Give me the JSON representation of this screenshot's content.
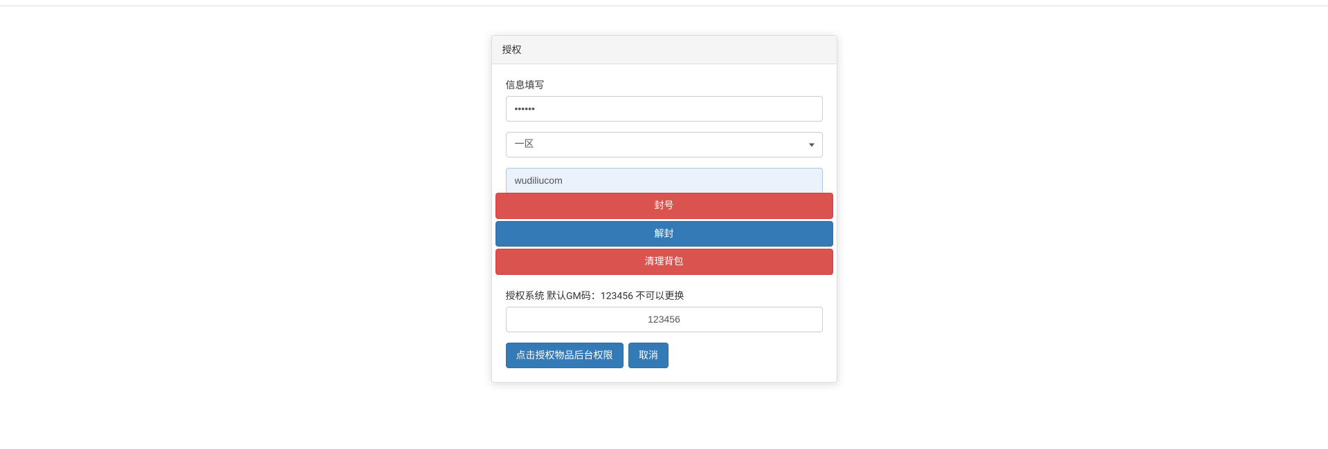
{
  "panel": {
    "title": "授权"
  },
  "form": {
    "info_label": "信息填写",
    "password_value": "••••••",
    "zone_selected": "一区",
    "account_value": "wudiliucom"
  },
  "actions": {
    "ban_label": "封号",
    "unban_label": "解封",
    "clear_bag_label": "清理背包"
  },
  "auth": {
    "gm_label": "授权系统 默认GM码：123456 不可以更换",
    "gm_value": "123456"
  },
  "footer": {
    "auth_button": "点击授权物品后台权限",
    "cancel_button": "取消"
  }
}
